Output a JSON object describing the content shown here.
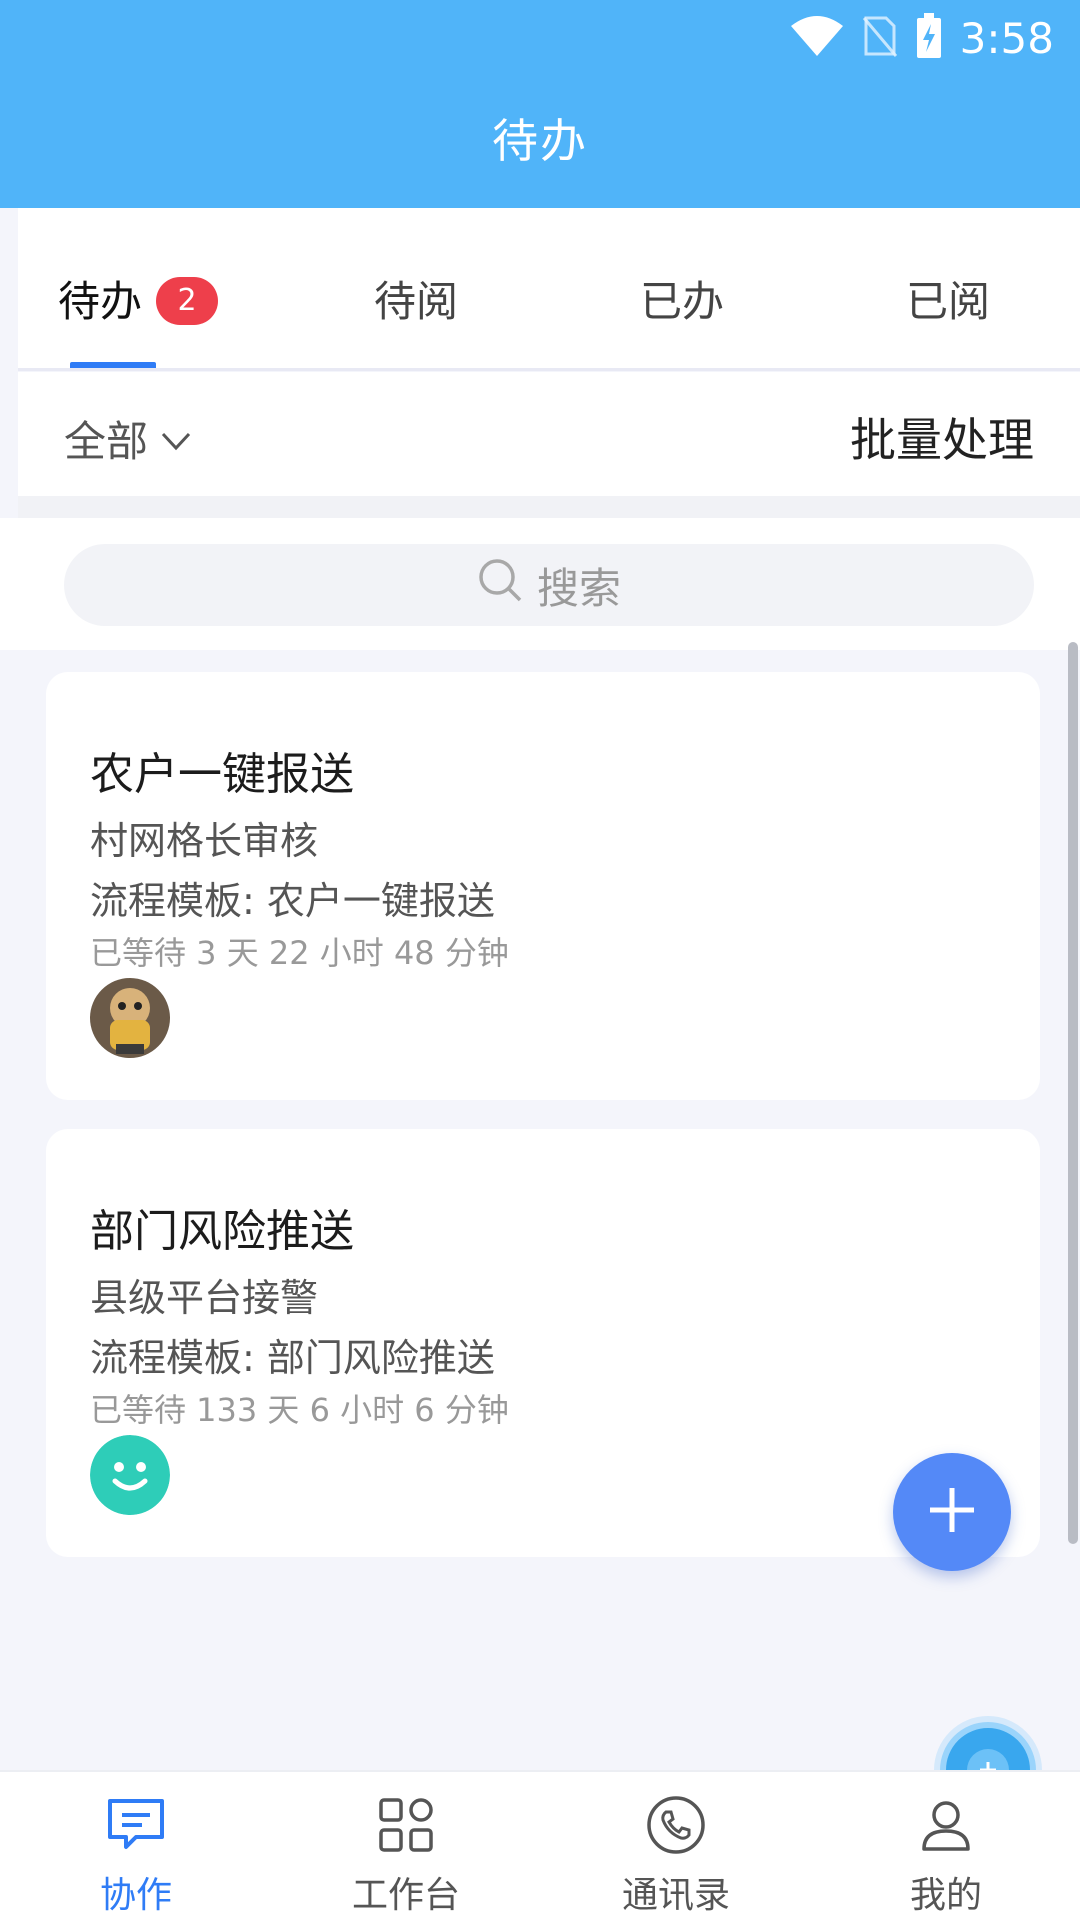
{
  "status_bar": {
    "time": "3:58"
  },
  "header": {
    "title": "待办"
  },
  "tabs": [
    {
      "label": "待办",
      "badge": "2",
      "active": true
    },
    {
      "label": "待阅"
    },
    {
      "label": "已办"
    },
    {
      "label": "已阅"
    }
  ],
  "filter": {
    "selected": "全部",
    "batch_label": "批量处理"
  },
  "search": {
    "placeholder": "搜索"
  },
  "cards": [
    {
      "title": "农户一键报送",
      "step": "村网格长审核",
      "flow": "流程模板: 农户一键报送",
      "wait": "已等待 3 天 22 小时 48 分钟",
      "avatar": "photo-avatar"
    },
    {
      "title": "部门风险推送",
      "step": "县级平台接警",
      "flow": "流程模板: 部门风险推送",
      "wait": "已等待 133 天 6 小时 6 分钟",
      "avatar": "smiley-avatar"
    }
  ],
  "bottom_nav": [
    {
      "label": "协作",
      "icon": "chat-icon",
      "active": true
    },
    {
      "label": "工作台",
      "icon": "grid-icon"
    },
    {
      "label": "通讯录",
      "icon": "phone-icon"
    },
    {
      "label": "我的",
      "icon": "person-icon"
    }
  ],
  "colors": {
    "primary": "#50b4f9",
    "accent": "#2f7cf6",
    "badge": "#ee3f4b",
    "fab": "#5489f7"
  }
}
